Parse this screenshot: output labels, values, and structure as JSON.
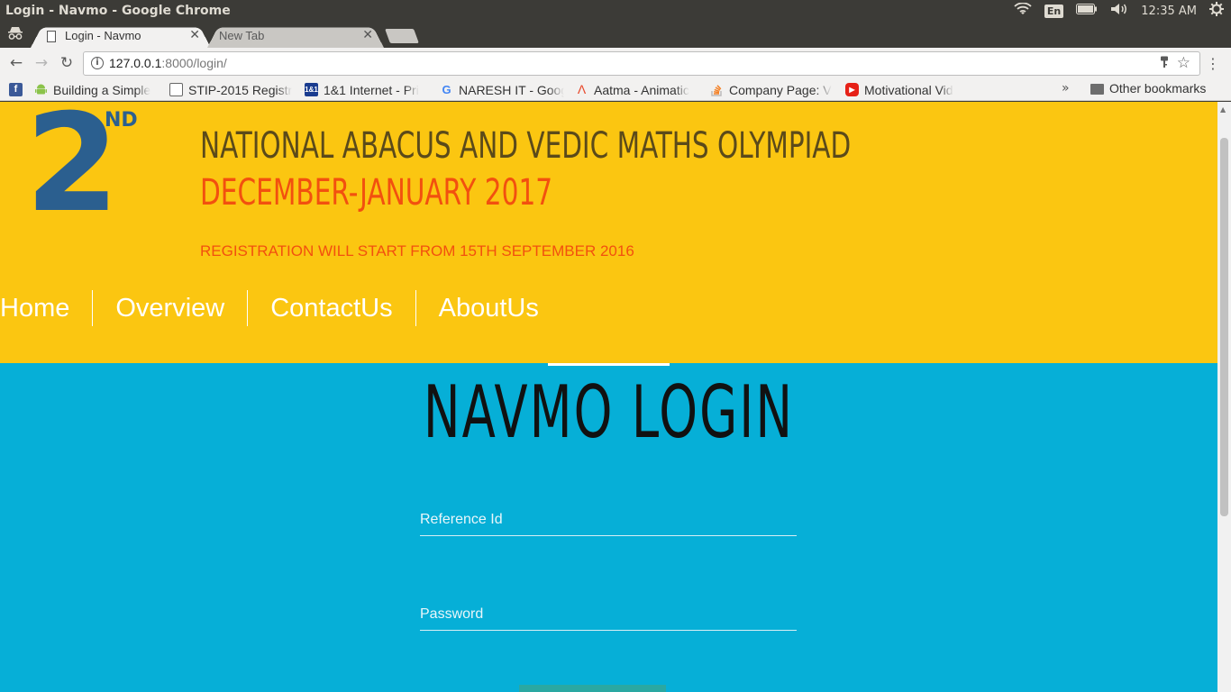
{
  "os": {
    "window_title": "Login - Navmo - Google Chrome",
    "language": "En",
    "time": "12:35 AM"
  },
  "tabs": [
    {
      "title": "Login - Navmo",
      "active": true
    },
    {
      "title": "New Tab",
      "active": false
    }
  ],
  "toolbar": {
    "url_host": "127.0.0.1",
    "url_rest": ":8000/login/"
  },
  "bookmarks": {
    "items": [
      {
        "label": "",
        "icon": "facebook-icon",
        "color": "#3b5998"
      },
      {
        "label": "Building a Simple",
        "icon": "android-icon",
        "color": "#8bc34a"
      },
      {
        "label": "STIP-2015 Registr",
        "icon": "document-icon",
        "color": "#ffffff"
      },
      {
        "label": "1&1 Internet - Pri",
        "icon": "ionos-icon",
        "color": "#1a3c8f"
      },
      {
        "label": "NARESH IT - Goog",
        "icon": "google-icon",
        "color": "#ffffff"
      },
      {
        "label": "Aatma - Animatic",
        "icon": "aatma-icon",
        "color": "#ffffff"
      },
      {
        "label": "Company Page: V",
        "icon": "stackoverflow-icon",
        "color": "#ffffff"
      },
      {
        "label": "Motivational Vid",
        "icon": "youtube-icon",
        "color": "#e62117"
      }
    ],
    "more": "»",
    "other": "Other bookmarks"
  },
  "page": {
    "logo_number": "2",
    "logo_suffix": "ND",
    "headline": "NATIONAL ABACUS AND VEDIC MATHS OLYMPIAD",
    "dates": "DECEMBER-JANUARY 2017",
    "registration": "REGISTRATION WILL START FROM 15TH SEPTEMBER 2016",
    "nav": [
      "Home",
      "Overview",
      "ContactUs",
      "AboutUs"
    ],
    "login_title": "NAVMO LOGIN",
    "reference_placeholder": "Reference Id",
    "password_placeholder": "Password",
    "colors": {
      "banner": "#fbc611",
      "login_bg": "#06afd7",
      "logo": "#2b5f8f",
      "accent_orange": "#f2500f"
    }
  }
}
